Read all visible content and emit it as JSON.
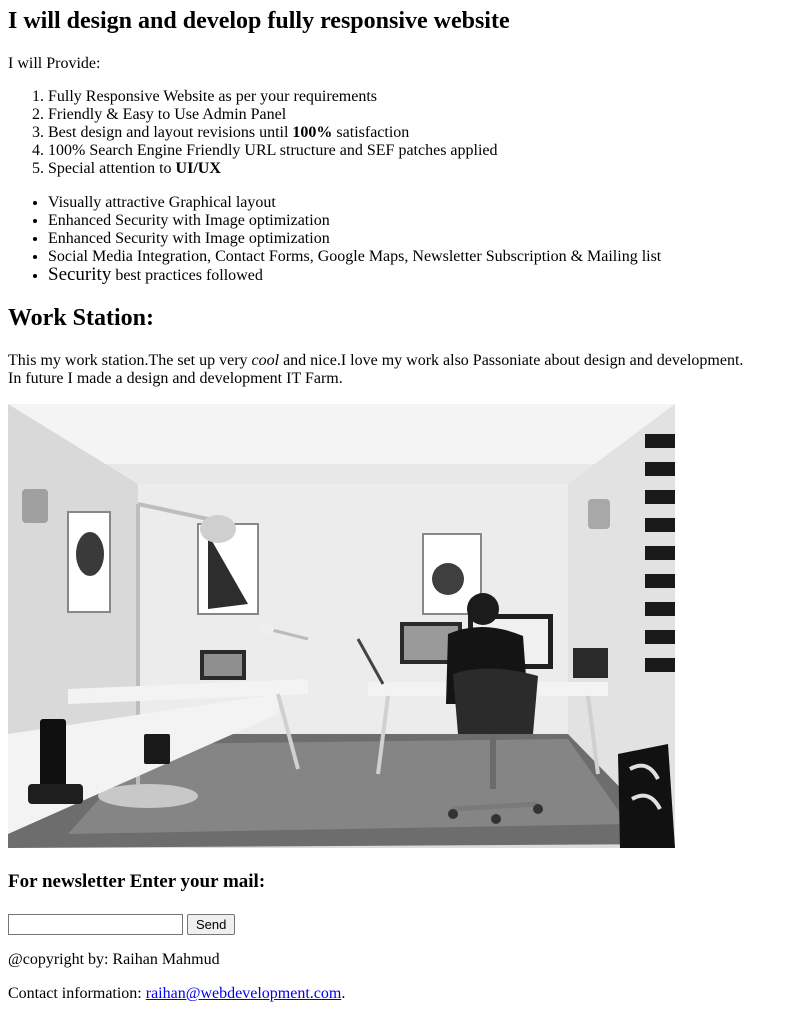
{
  "page": {
    "title": "I will design and develop fully responsive website",
    "intro": "I will Provide:",
    "ordered_items": [
      {
        "pre": "Fully Responsive Website as per your requirements",
        "bold": "",
        "post": ""
      },
      {
        "pre": "Friendly & Easy to Use Admin Panel",
        "bold": "",
        "post": ""
      },
      {
        "pre": "Best design and layout revisions until ",
        "bold": "100%",
        "post": " satisfaction"
      },
      {
        "pre": "100% Search Engine Friendly URL structure and SEF patches applied",
        "bold": "",
        "post": ""
      },
      {
        "pre": "Special attention to ",
        "bold": "UI/UX",
        "post": ""
      }
    ],
    "bullet_items": [
      "Visually attractive Graphical layout",
      "Enhanced Security with Image optimization",
      "Enhanced Security with Image optimization",
      "Social Media Integration, Contact Forms, Google Maps, Newsletter Subscription & Mailing list"
    ],
    "last_bullet": {
      "big": "Security",
      "rest": " best practices followed"
    },
    "workstation": {
      "heading": "Work Station:",
      "line1_pre": "This my work station.The set up very ",
      "line1_em": "cool",
      "line1_post": " and nice.I love my work also Passoniate about design and development.",
      "line2": "In future I made a design and development IT Farm."
    },
    "newsletter": {
      "heading": "For newsletter Enter your mail:",
      "input_value": "",
      "button_label": "Send"
    },
    "footer": {
      "copyright": "@copyright by: Raihan Mahmud",
      "contact_label": "Contact information: ",
      "contact_email": "raihan@webdevelopment.com",
      "contact_suffix": "."
    }
  }
}
